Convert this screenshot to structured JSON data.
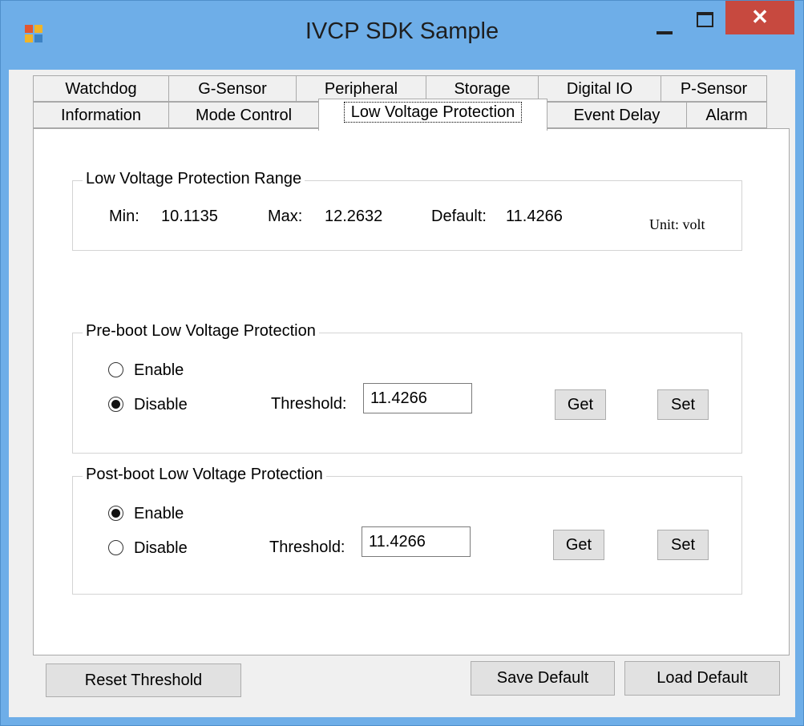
{
  "window": {
    "title": "IVCP SDK Sample",
    "close_glyph": "✕",
    "icons": [
      "app-icon",
      "minimize-icon",
      "maximize-icon",
      "close-icon"
    ]
  },
  "tabs": {
    "row1": [
      "Watchdog",
      "G-Sensor",
      "Peripheral",
      "Storage",
      "Digital IO",
      "P-Sensor"
    ],
    "row2": [
      "Information",
      "Mode Control",
      "Low Voltage Protection",
      "Event Delay",
      "Alarm"
    ],
    "active": "Low Voltage Protection"
  },
  "range": {
    "title": "Low Voltage Protection Range",
    "min_label": "Min:",
    "min_value": "10.1135",
    "max_label": "Max:",
    "max_value": "12.2632",
    "default_label": "Default:",
    "default_value": "11.4266",
    "unit": "Unit: volt"
  },
  "preboot": {
    "title": "Pre-boot Low Voltage Protection",
    "enable_label": "Enable",
    "disable_label": "Disable",
    "selected": "Disable",
    "threshold_label": "Threshold:",
    "threshold_value": "11.4266",
    "get_label": "Get",
    "set_label": "Set"
  },
  "postboot": {
    "title": "Post-boot Low Voltage Protection",
    "enable_label": "Enable",
    "disable_label": "Disable",
    "selected": "Enable",
    "threshold_label": "Threshold:",
    "threshold_value": "11.4266",
    "get_label": "Get",
    "set_label": "Set"
  },
  "bottom": {
    "reset_label": "Reset Threshold",
    "save_label": "Save Default",
    "load_label": "Load Default"
  },
  "colors": {
    "title_bar": "#6eaee8",
    "close_button": "#c7493f",
    "panel": "#ffffff",
    "form_bg": "#f0f0f0"
  }
}
